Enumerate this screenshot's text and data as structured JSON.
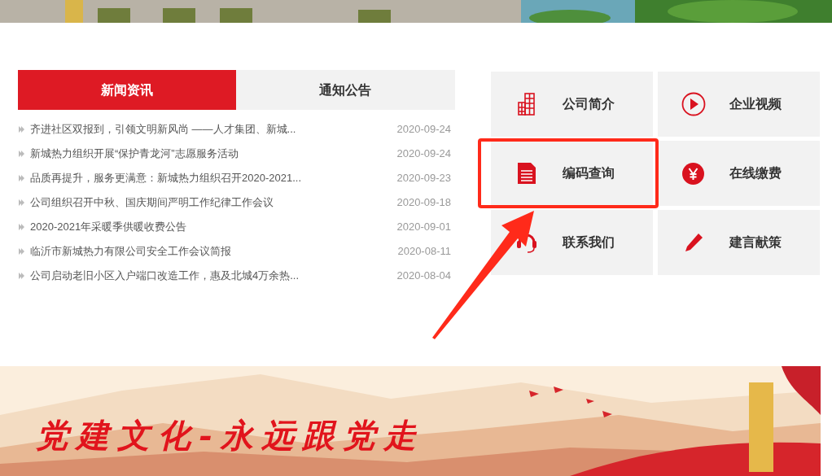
{
  "news": {
    "tabs": [
      {
        "label": "新闻资讯",
        "selected": true
      },
      {
        "label": "通知公告",
        "selected": false
      }
    ],
    "items": [
      {
        "title": "齐进社区双报到，引领文明新风尚 ——人才集团、新城...",
        "date": "2020-09-24"
      },
      {
        "title": "新城热力组织开展“保护青龙河”志愿服务活动",
        "date": "2020-09-24"
      },
      {
        "title": "品质再提升，服务更满意：新城热力组织召开2020-2021...",
        "date": "2020-09-23"
      },
      {
        "title": "公司组织召开中秋、国庆期间严明工作纪律工作会议",
        "date": "2020-09-18"
      },
      {
        "title": "2020-2021年采暖季供暖收费公告",
        "date": "2020-09-01"
      },
      {
        "title": "临沂市新城热力有限公司安全工作会议简报",
        "date": "2020-08-11"
      },
      {
        "title": "公司启动老旧小区入户端口改造工作，惠及北城4万余热...",
        "date": "2020-08-04"
      }
    ]
  },
  "quick_links": [
    {
      "kind": "building",
      "label": "公司简介",
      "highlighted": false
    },
    {
      "kind": "play",
      "label": "企业视频",
      "highlighted": false
    },
    {
      "kind": "document",
      "label": "编码查询",
      "highlighted": true
    },
    {
      "kind": "yuan",
      "label": "在线缴费",
      "highlighted": false
    },
    {
      "kind": "headset",
      "label": "联系我们",
      "highlighted": false
    },
    {
      "kind": "pencil",
      "label": "建言献策",
      "highlighted": false
    }
  ],
  "banner": {
    "title": "党建文化-永远跟党走"
  }
}
